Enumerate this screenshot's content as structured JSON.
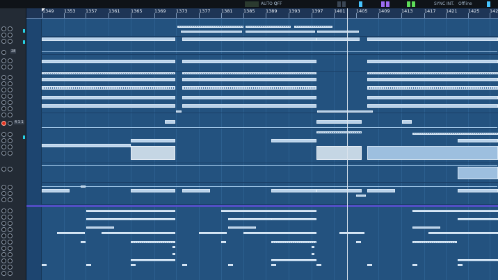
{
  "transport": {
    "mode_label": "",
    "auto_label": "AUTO Q",
    "off_label": "OFF",
    "sync_label": "SYNC",
    "int_label": "INT.",
    "offline_label": "Offline"
  },
  "ruler": {
    "bars": [
      "1349",
      "1353",
      "1357",
      "1361",
      "1365",
      "1369",
      "1373",
      "1377",
      "1381",
      "1385",
      "1389",
      "1393",
      "1397",
      "1401",
      "1405",
      "1409",
      "1413",
      "1417",
      "1421",
      "1425",
      "142"
    ]
  },
  "tracks": {
    "label_a": "28",
    "label_b": "4 1 1"
  },
  "colors": {
    "arrange_bg": "#23527f",
    "clip_fill": "#b9d2ea",
    "playhead": "#d9e2ec",
    "record": "#e0301e",
    "accent_cyan": "#27d3e6",
    "marker_purple": "#5a4fd1"
  }
}
